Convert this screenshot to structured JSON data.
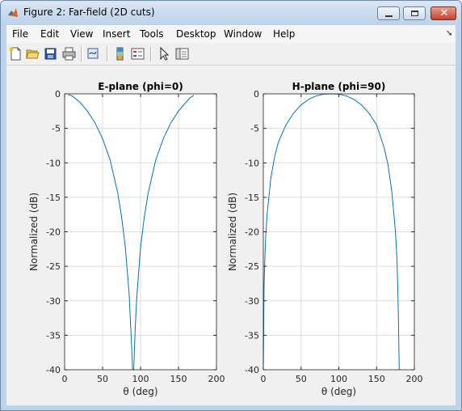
{
  "window": {
    "title": "Figure 2: Far-field (2D cuts)"
  },
  "menu": [
    "File",
    "Edit",
    "View",
    "Insert",
    "Tools",
    "Desktop",
    "Window",
    "Help"
  ],
  "toolbar_icons": [
    "new-figure-icon",
    "open-file-icon",
    "save-icon",
    "print-icon",
    "link-plot-icon",
    "colorbar-icon",
    "legend-icon",
    "edit-plot-arrow-icon",
    "property-inspector-icon"
  ],
  "chart_data": [
    {
      "type": "line",
      "title": "E-plane (phi=0)",
      "xlabel": "θ (deg)",
      "ylabel": "Normalized (dB)",
      "xlim": [
        0,
        200
      ],
      "ylim": [
        -40,
        0
      ],
      "xticks": [
        "0",
        "50",
        "100",
        "150",
        "200"
      ],
      "yticks": [
        "0",
        "-5",
        "-10",
        "-15",
        "-20",
        "-25",
        "-30",
        "-35",
        "-40"
      ],
      "grid": true,
      "color": "#0072bd",
      "series": [
        {
          "x": [
            5,
            10,
            20,
            30,
            40,
            50,
            60,
            70,
            75,
            80,
            85,
            88,
            89.5,
            91,
            93,
            95,
            100,
            105,
            110,
            120,
            130,
            140,
            150,
            160,
            165,
            170
          ],
          "y": [
            -0.1,
            -0.3,
            -1.2,
            -2.5,
            -4.2,
            -6.5,
            -9.6,
            -14.4,
            -17.8,
            -22.3,
            -29,
            -36,
            -40,
            -40,
            -34,
            -29.5,
            -22.3,
            -17.8,
            -14.4,
            -9.6,
            -6.5,
            -4.2,
            -2.5,
            -1.2,
            -0.6,
            -0.2
          ]
        }
      ]
    },
    {
      "type": "line",
      "title": "H-plane (phi=90)",
      "xlabel": "θ (deg)",
      "ylabel": "Normalized (dB)",
      "xlim": [
        0,
        200
      ],
      "ylim": [
        -40,
        0
      ],
      "xticks": [
        "0",
        "50",
        "100",
        "150",
        "200"
      ],
      "yticks": [
        "0",
        "-5",
        "-10",
        "-15",
        "-20",
        "-25",
        "-30",
        "-35",
        "-40"
      ],
      "grid": true,
      "color": "#0072bd",
      "series": [
        {
          "x": [
            0,
            0.5,
            1,
            2,
            3,
            5,
            10,
            15,
            20,
            30,
            40,
            50,
            60,
            70,
            80,
            90,
            100,
            110,
            120,
            130,
            140,
            150,
            160,
            165,
            170,
            175,
            177,
            178,
            179,
            180
          ],
          "y": [
            -40,
            -34,
            -28,
            -24,
            -21,
            -17.5,
            -12.2,
            -9.1,
            -7.0,
            -4.5,
            -2.8,
            -1.6,
            -0.8,
            -0.3,
            -0.05,
            0,
            -0.05,
            -0.3,
            -0.8,
            -1.6,
            -2.8,
            -4.5,
            -7.8,
            -10.2,
            -14,
            -20,
            -24,
            -28,
            -33,
            -40
          ]
        }
      ]
    }
  ]
}
